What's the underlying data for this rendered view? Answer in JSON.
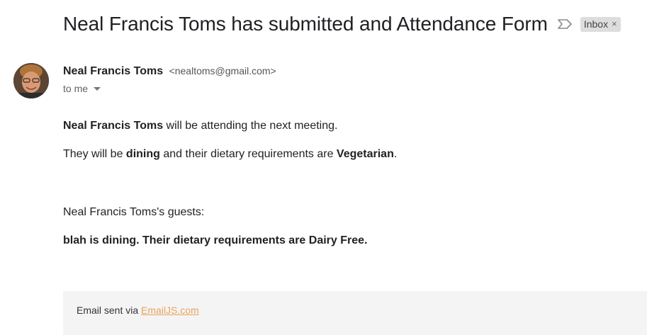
{
  "email": {
    "subject": "Neal Francis Toms has submitted and Attendance Form",
    "label": "Inbox",
    "label_close": "×",
    "sender_name": "Neal Francis Toms",
    "sender_email": "<nealtoms@gmail.com>",
    "recipients": "to me",
    "body": {
      "line1_name": "Neal Francis Toms",
      "line1_rest": " will be attending the next meeting.",
      "line2_a": "They will be ",
      "line2_dining": "dining",
      "line2_b": " and their dietary requirements are ",
      "line2_diet": "Vegetarian",
      "line2_end": ".",
      "guests_heading": "Neal Francis Toms's guests:",
      "guest_line": "blah is dining. Their dietary requirements are Dairy Free."
    },
    "footer": {
      "prefix": "Email sent via ",
      "link": "EmailJS.com"
    }
  },
  "colors": {
    "footer_link": "#e8a35c",
    "chip_bg": "#dddddd",
    "footer_bg": "#f4f4f4"
  },
  "icons": {
    "importance": "importance-marker-icon",
    "dropdown": "chevron-down-icon"
  }
}
